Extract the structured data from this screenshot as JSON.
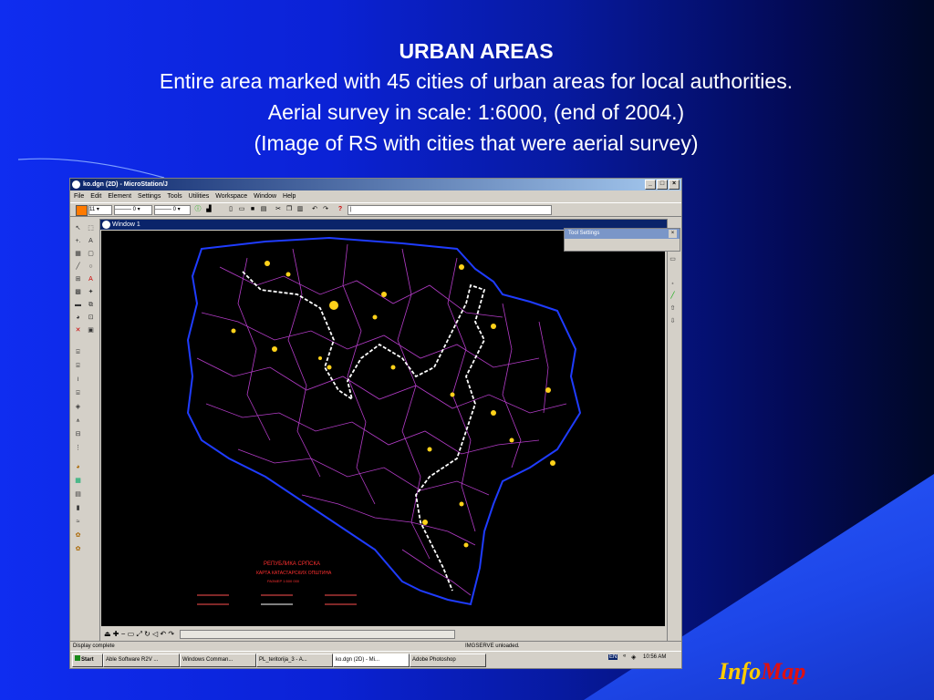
{
  "slide": {
    "title": "URBAN AREAS",
    "line1": "Entire area marked with 45 cities of urban areas for local authorities.",
    "line2": "Aerial survey in scale: 1:6000, (end of 2004.)",
    "line3": "(Image of RS with cities that were aerial survey)"
  },
  "window": {
    "title": "ko.dgn (2D) - MicroStation/J",
    "buttons": [
      "_",
      "□",
      "×"
    ]
  },
  "menu": [
    "File",
    "Edit",
    "Element",
    "Settings",
    "Tools",
    "Utilities",
    "Workspace",
    "Window",
    "Help"
  ],
  "toolbar": {
    "level_value": "11",
    "style_value": "0",
    "weight_value": "0"
  },
  "view": {
    "title": "Window 1"
  },
  "tool_settings": {
    "title": "Tool Settings",
    "close": "×"
  },
  "map_legend": {
    "line1": "РЕПУБЛИКА СРПСКА",
    "line2": "КАРТА КАТАСТАРСКИХ ОПШТИНА",
    "line3": "РАЗМЕР 1:500 000"
  },
  "status": {
    "left": "Display complete",
    "right": "IMGSERVE unloaded."
  },
  "taskbar": {
    "start": "Start",
    "items": [
      "Able Software R2V ...",
      "Windows Comman...",
      "PL_teritorija_3 - A...",
      "ko.dgn (2D) - Mi...",
      "Adobe Photoshop"
    ],
    "lang": "EN",
    "clock": "10:56 AM"
  },
  "brand": {
    "part1": "Info",
    "part2": "Map"
  },
  "colors": {
    "background": "#0b22d6",
    "map_border": "#1f3cff",
    "municipal_lines": "#b43cc8",
    "urban_areas": "#ffd21a",
    "brand_info": "#ffcc00",
    "brand_map": "#e01010"
  }
}
